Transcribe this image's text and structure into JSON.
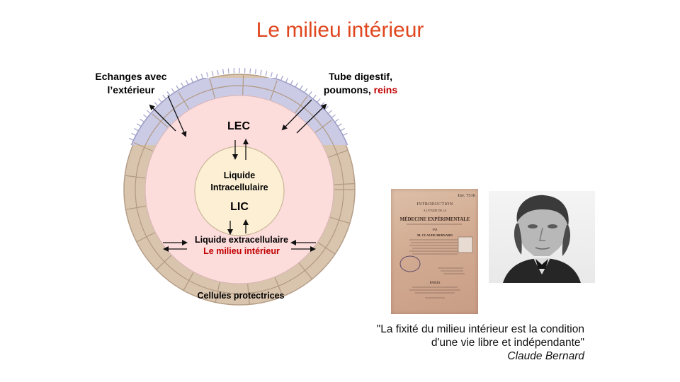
{
  "title": "Le milieu intérieur",
  "diagram": {
    "top_left_label_line1": "Echanges avec",
    "top_left_label_line2": "l’extérieur",
    "top_right_label_line1": "Tube digestif,",
    "top_right_label_prefix": "poumons, ",
    "top_right_label_highlight": "reins",
    "lec_label": "LEC",
    "lic_name_line1": "Liquide",
    "lic_name_line2": "Intracellulaire",
    "lic_label": "LIC",
    "extracellular_line1": "Liquide extracellulaire",
    "extracellular_line2": "Le milieu intérieur",
    "bottom_label": "Cellules protectrices",
    "colors": {
      "outer_ring": "#d9c4ae",
      "lec_fill": "#fddcdc",
      "lic_fill": "#fcefd4",
      "epithelium": "#cbcbe6",
      "highlight": "#c00000",
      "title": "#e0461e"
    }
  },
  "book": {
    "stamp": "Inv. 7516",
    "line1": "INTRODUCTION",
    "line2": "A L'ETUDE DE LA",
    "line3": "MÉDECINE EXPÉRIMENTALE",
    "line4": "PAR",
    "author": "M. CLAUDE BERNARD",
    "city": "PARIS"
  },
  "quote": {
    "line1": "\"La fixité du milieu intérieur est la condition",
    "line2": "d'une vie libre et indépendante\"",
    "author": "Claude Bernard"
  }
}
